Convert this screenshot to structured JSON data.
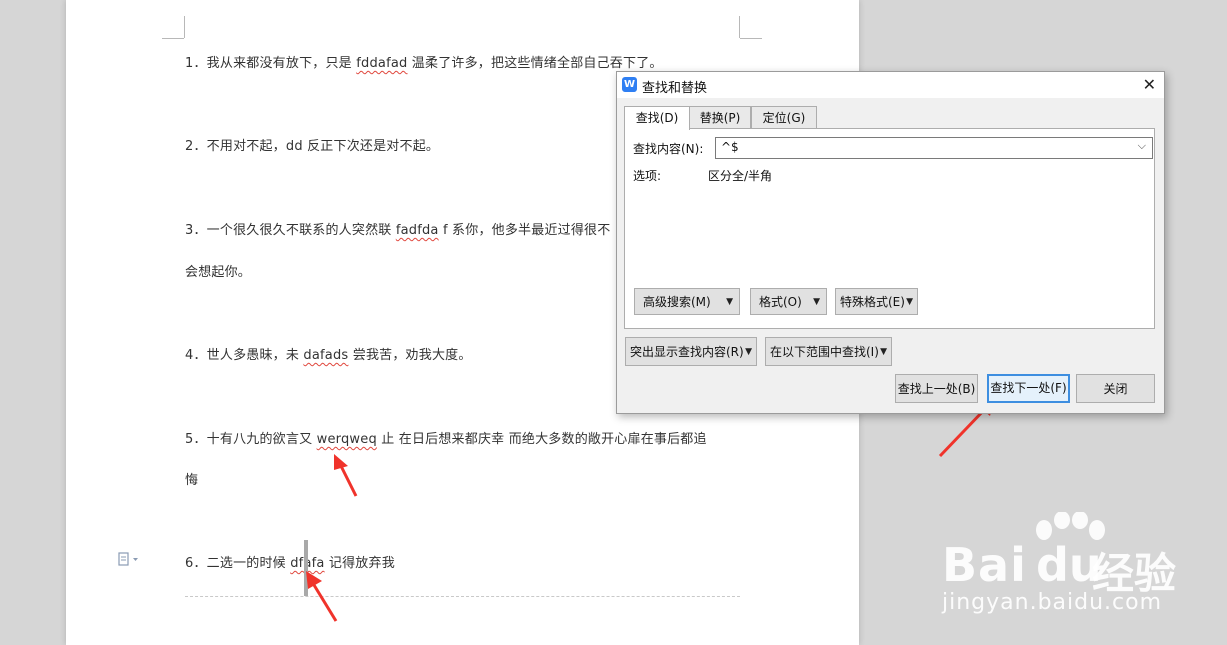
{
  "document": {
    "lines": [
      {
        "prefix": "1．我从来都没有放下，只是 ",
        "error": "fddafad",
        "suffix": " 温柔了许多，把这些情绪全部自己吞下了。"
      },
      {
        "prefix": "2．不用对不起，dd 反正下次还是对不起。",
        "error": "",
        "suffix": ""
      },
      {
        "prefix": "3．一个很久很久不联系的人突然联 ",
        "error": "fadfda",
        "suffix": " f 系你，他多半最近过得很不"
      },
      {
        "prefix": "会想起你。",
        "error": "",
        "suffix": ""
      },
      {
        "prefix": "4．世人多愚昧，未 ",
        "error": "dafads",
        "suffix": " 尝我苦，劝我大度。"
      },
      {
        "prefix": "5．十有八九的欲言又 ",
        "error": "werqweq",
        "suffix": " 止  在日后想来都庆幸  而绝大多数的敞开心扉在事后都追"
      },
      {
        "prefix": "悔",
        "error": "",
        "suffix": ""
      },
      {
        "prefix": "6．二选一的时候 ",
        "error": "dfafa",
        "suffix": " 记得放弃我"
      }
    ]
  },
  "dialog": {
    "title": "查找和替换",
    "tabs": [
      "查找(D)",
      "替换(P)",
      "定位(G)"
    ],
    "find_label": "查找内容(N):",
    "find_value": "^$",
    "options_label": "选项:",
    "options_value": "区分全/半角",
    "advanced_search": "高级搜索(M)",
    "format": "格式(O)",
    "special_format": "特殊格式(E)",
    "highlight": "突出显示查找内容(R)",
    "find_in": "在以下范围中查找(I)",
    "find_prev": "查找上一处(B)",
    "find_next": "查找下一处(F)",
    "close": "关闭"
  },
  "watermark": {
    "brand_latin_1": "Bai",
    "brand_latin_2": "du",
    "brand_cn": "经验",
    "url": "jingyan.baidu.com"
  },
  "colors": {
    "accent": "#3d8ee0",
    "arrow": "#f0332b",
    "squiggle": "#e0463c"
  }
}
